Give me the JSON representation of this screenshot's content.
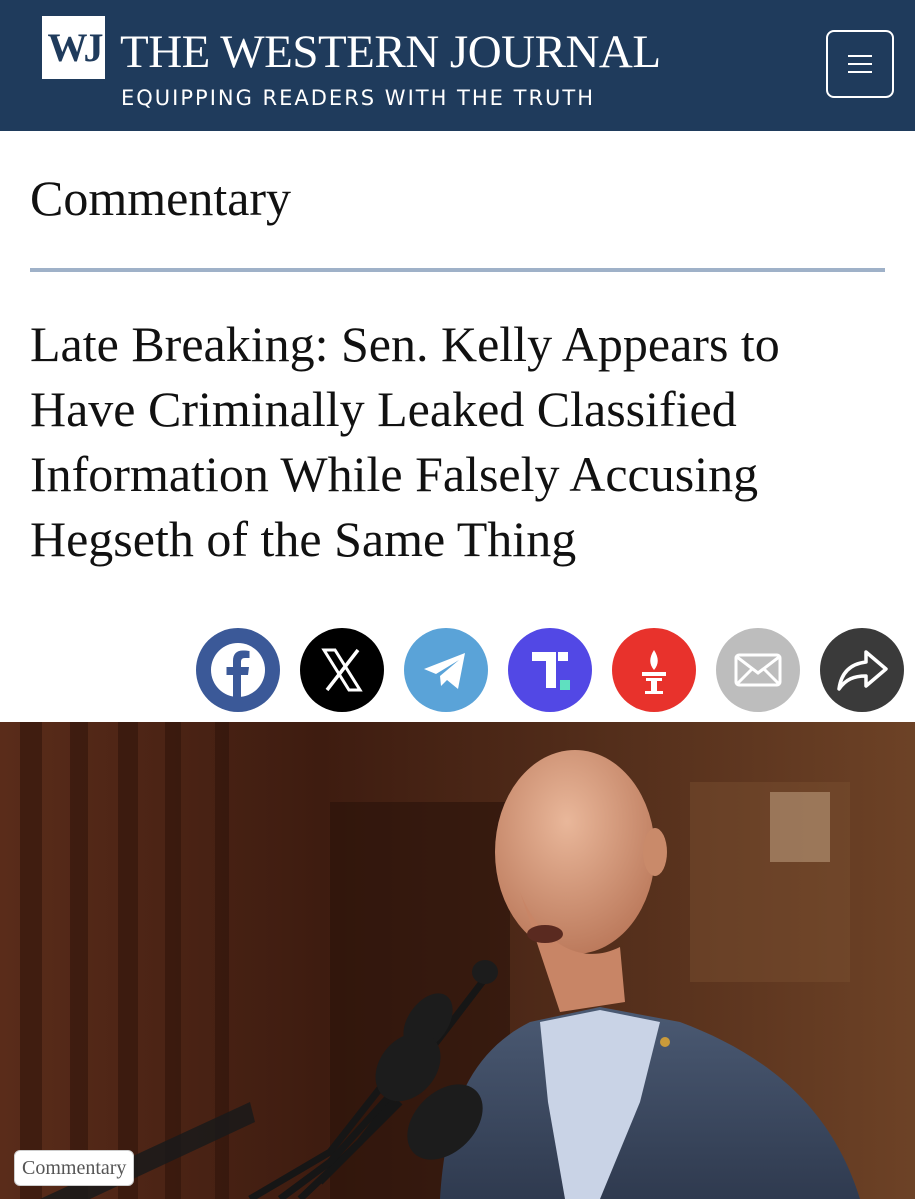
{
  "header": {
    "logo_text": "WJ",
    "site_name": "THE WESTERN JOURNAL",
    "tagline": "EQUIPPING READERS WITH THE TRUTH",
    "menu_icon": "hamburger-menu-icon",
    "bg_color": "#1f3b5c"
  },
  "article": {
    "section": "Commentary",
    "headline": "Late Breaking: Sen. Kelly Appears to Have Criminally Leaked Classified Information While Falsely Accusing Hegseth of the Same Thing",
    "image_caption": "Commentary"
  },
  "share": [
    {
      "name": "facebook",
      "icon": "facebook-icon",
      "color": "#3b5998"
    },
    {
      "name": "x",
      "icon": "x-icon",
      "color": "#000000"
    },
    {
      "name": "telegram",
      "icon": "telegram-icon",
      "color": "#5aa3d8"
    },
    {
      "name": "truth-social",
      "icon": "truth-social-icon",
      "color": "#5248e5"
    },
    {
      "name": "gettr",
      "icon": "gettr-icon",
      "color": "#e8322c"
    },
    {
      "name": "email",
      "icon": "email-icon",
      "color": "#bdbdbd"
    },
    {
      "name": "share",
      "icon": "share-arrow-icon",
      "color": "#3a3a3a"
    }
  ]
}
